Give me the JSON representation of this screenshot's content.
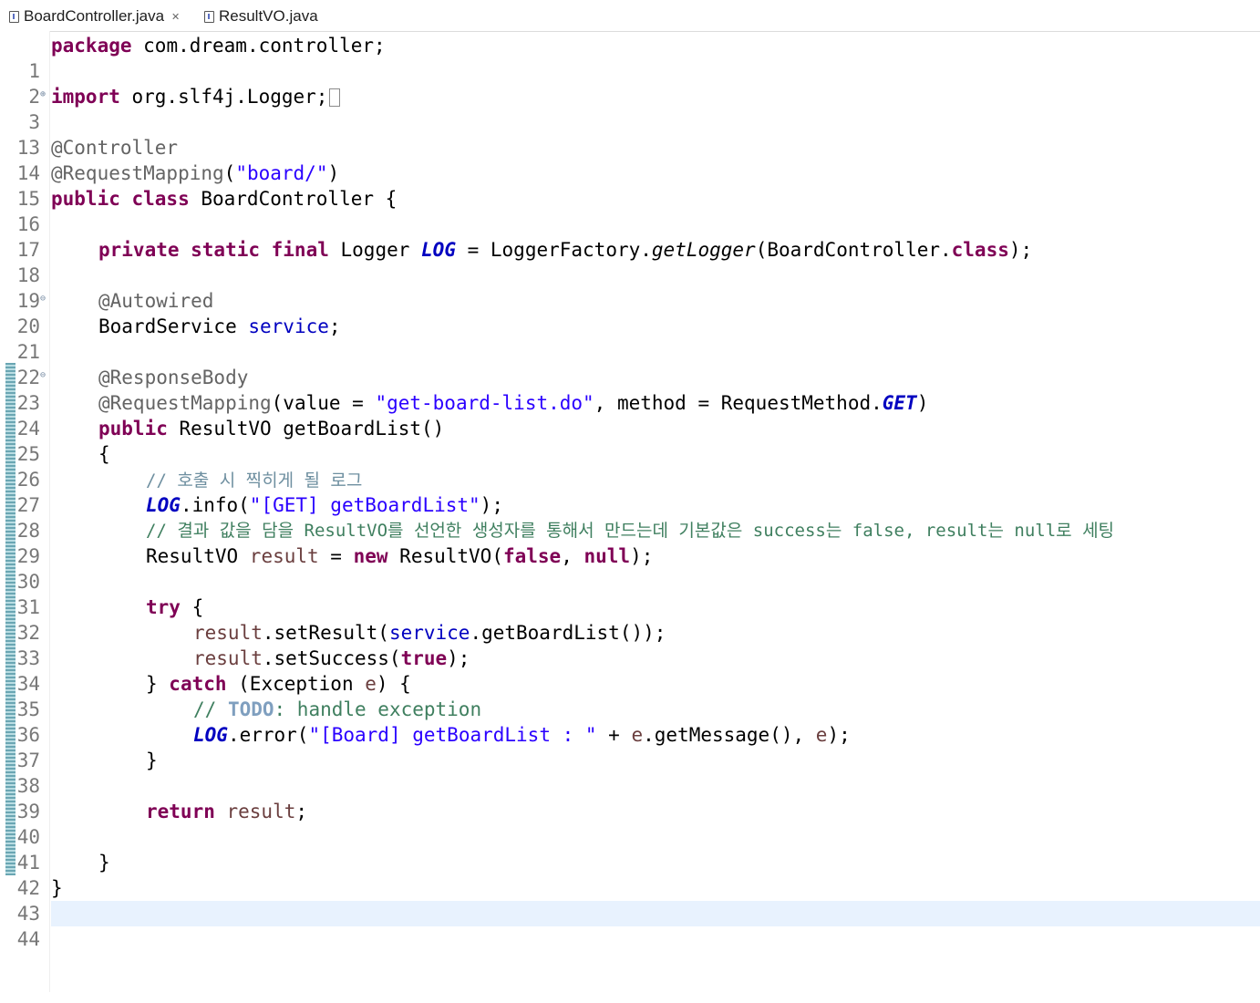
{
  "tabs": [
    {
      "label": "BoardController.java",
      "close": "✕",
      "active": true
    },
    {
      "label": "ResultVO.java",
      "active": false
    }
  ],
  "line_numbers": [
    "1",
    "2",
    "3",
    "13",
    "14",
    "15",
    "16",
    "17",
    "18",
    "19",
    "20",
    "21",
    "22",
    "23",
    "24",
    "25",
    "26",
    "27",
    "28",
    "29",
    "30",
    "31",
    "32",
    "33",
    "34",
    "35",
    "36",
    "37",
    "38",
    "39",
    "40",
    "41",
    "42",
    "43",
    "44"
  ],
  "code": {
    "l1_kw": "package",
    "l1_rest": " com.dream.controller;",
    "l3_kw": "import",
    "l3_rest": " org.slf4j.Logger;",
    "l14": "@Controller",
    "l15_ann": "@RequestMapping",
    "l15_open": "(",
    "l15_str": "\"board/\"",
    "l15_close": ")",
    "l16_kw": "public class",
    "l16_rest": " BoardController {",
    "l18_kw": "private static final",
    "l18_type": " Logger ",
    "l18_field": "LOG",
    "l18_mid": " = LoggerFactory.",
    "l18_method": "getLogger",
    "l18_arg": "(BoardController.",
    "l18_kw2": "class",
    "l18_end": ");",
    "l20": "@Autowired",
    "l21_type": "BoardService ",
    "l21_field": "service",
    "l21_end": ";",
    "l23": "@ResponseBody",
    "l24_ann": "@RequestMapping",
    "l24_a": "(value = ",
    "l24_str": "\"get-board-list.do\"",
    "l24_b": ", method = RequestMethod.",
    "l24_get": "GET",
    "l24_c": ")",
    "l25_kw": "public",
    "l25_rest": " ResultVO getBoardList()",
    "l26": "{",
    "l27": "// 호출 시 찍히게 될 로그",
    "l28_log": "LOG",
    "l28_a": ".info(",
    "l28_str": "\"[GET] getBoardList\"",
    "l28_b": ");",
    "l29": "// 결과 값을 담을 ResultVO를 선언한 생성자를 통해서 만드는데 기본값은 success는 false, result는 null로 세팅",
    "l30_a": "ResultVO ",
    "l30_var": "result",
    "l30_b": " = ",
    "l30_kw": "new",
    "l30_c": " ResultVO(",
    "l30_false": "false",
    "l30_d": ", ",
    "l30_null": "null",
    "l30_e": ");",
    "l32_kw": "try",
    "l32_rest": " {",
    "l33_var": "result",
    "l33_a": ".setResult(",
    "l33_field": "service",
    "l33_b": ".getBoardList());",
    "l34_var": "result",
    "l34_a": ".setSuccess(",
    "l34_true": "true",
    "l34_b": ");",
    "l35_a": "} ",
    "l35_kw": "catch",
    "l35_b": " (Exception ",
    "l35_var": "e",
    "l35_c": ") {",
    "l36_a": "// ",
    "l36_todo": "TODO",
    "l36_b": ": handle exception",
    "l37_log": "LOG",
    "l37_a": ".error(",
    "l37_str": "\"[Board] getBoardList : \"",
    "l37_b": " + ",
    "l37_var": "e",
    "l37_c": ".getMessage(), ",
    "l37_var2": "e",
    "l37_d": ");",
    "l38": "}",
    "l40_kw": "return",
    "l40_var": " result",
    "l40_end": ";",
    "l42": "}",
    "l43": "}"
  },
  "colors": {
    "keyword": "#7f0055",
    "string": "#2a00ff",
    "comment": "#3f7f5f",
    "annotation": "#646464",
    "field": "#0000c0",
    "current_line": "#e8f2fe"
  }
}
